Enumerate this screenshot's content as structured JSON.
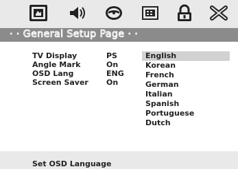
{
  "toolbar": {
    "items": [
      {
        "icon": "general-setup-icon"
      },
      {
        "icon": "audio-speaker-icon"
      },
      {
        "icon": "video-disc-icon"
      },
      {
        "icon": "preference-icon"
      },
      {
        "icon": "lock-icon"
      },
      {
        "icon": "exit-icon"
      }
    ]
  },
  "page_title": "· · General Setup Page · ·",
  "settings": [
    {
      "label": "TV Display",
      "value": "PS"
    },
    {
      "label": "Angle Mark",
      "value": "On"
    },
    {
      "label": "OSD Lang",
      "value": "ENG"
    },
    {
      "label": "Screen Saver",
      "value": "On"
    }
  ],
  "selected_setting_index": 2,
  "language_options": [
    "English",
    "Korean",
    "French",
    "German",
    "Italian",
    "Spanish",
    "Portuguese",
    "Dutch"
  ],
  "highlighted_option_index": 0,
  "status_text": "Set OSD Language",
  "colors": {
    "toolbar_bg": "#e9e9e9",
    "title_bar_bg": "#8b8b8b",
    "content_bg": "#ffffff",
    "highlight_bg": "#d2d2d2",
    "text": "#222222"
  }
}
